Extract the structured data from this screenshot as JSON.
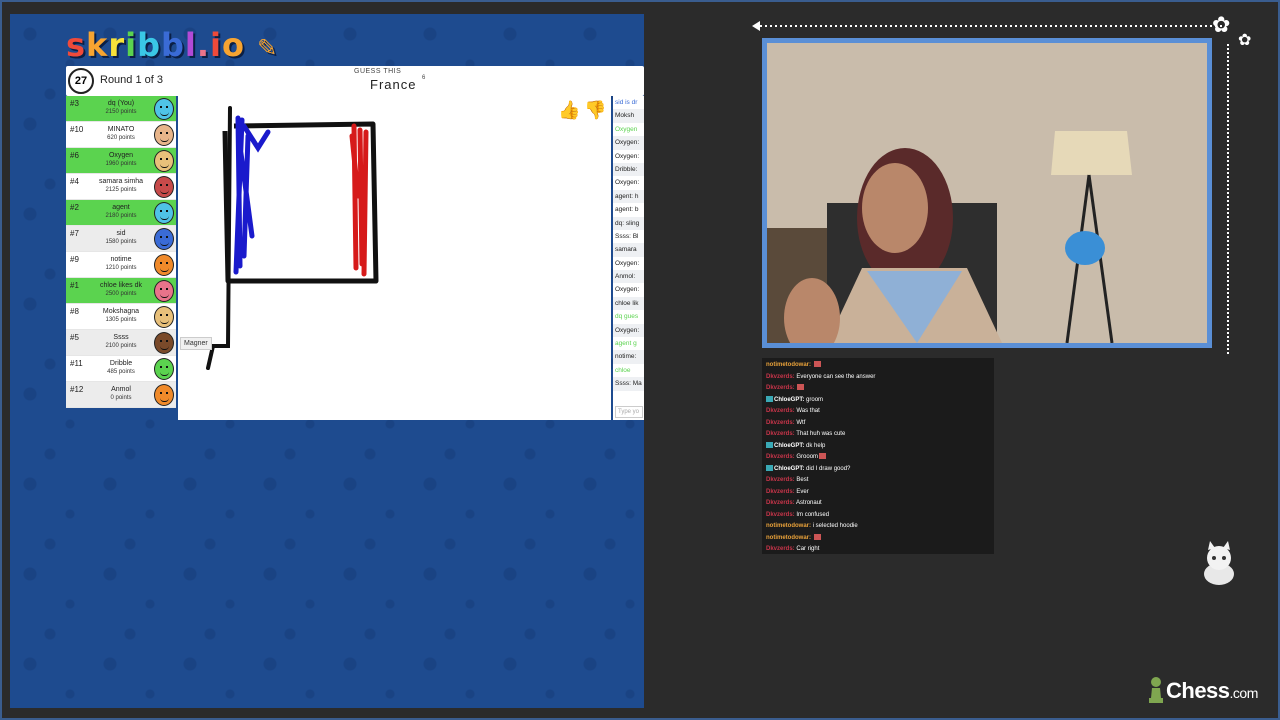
{
  "game": {
    "logo": "skribbl.io",
    "timer": "27",
    "round": "Round 1 of 3",
    "guess_label": "GUESS THIS",
    "word": "France",
    "word_length": "6",
    "drawer_tag": "Magner",
    "chat_placeholder": "Type yo",
    "players": [
      {
        "rank": "#3",
        "name": "dq (You)",
        "points": "2150 points",
        "style": "green",
        "avatar_color": "#4fc3e6"
      },
      {
        "rank": "#10",
        "name": "MINATO",
        "points": "620 points",
        "style": "white",
        "avatar_color": "#e8b58a"
      },
      {
        "rank": "#6",
        "name": "Oxygen",
        "points": "1960 points",
        "style": "green",
        "avatar_color": "#e8c07a"
      },
      {
        "rank": "#4",
        "name": "samara simha",
        "points": "2125 points",
        "style": "white",
        "avatar_color": "#c74a4a"
      },
      {
        "rank": "#2",
        "name": "agent",
        "points": "2180 points",
        "style": "green",
        "avatar_color": "#4fc3e6"
      },
      {
        "rank": "#7",
        "name": "sid",
        "points": "1580 points",
        "style": "grey",
        "avatar_color": "#3a6bd6"
      },
      {
        "rank": "#9",
        "name": "notime",
        "points": "1210 points",
        "style": "white",
        "avatar_color": "#f08a2a"
      },
      {
        "rank": "#1",
        "name": "chloe likes dk",
        "points": "2500 points",
        "style": "green",
        "avatar_color": "#e8738a"
      },
      {
        "rank": "#8",
        "name": "Mokshagna",
        "points": "1305 points",
        "style": "white",
        "avatar_color": "#e8c07a"
      },
      {
        "rank": "#5",
        "name": "Ssss",
        "points": "2100 points",
        "style": "grey",
        "avatar_color": "#7a4a2a"
      },
      {
        "rank": "#11",
        "name": "Dribble",
        "points": "485 points",
        "style": "white",
        "avatar_color": "#5bd34f"
      },
      {
        "rank": "#12",
        "name": "Anmol",
        "points": "0 points",
        "style": "grey",
        "avatar_color": "#f08a2a"
      }
    ],
    "chat": [
      {
        "text": "sid is dr",
        "style": "bluemsg"
      },
      {
        "text": "Moksh",
        "style": ""
      },
      {
        "text": "Oxygen",
        "style": "greenmsg"
      },
      {
        "text": "Oxygen:",
        "style": ""
      },
      {
        "text": "Oxygen:",
        "style": ""
      },
      {
        "text": "Dribble:",
        "style": ""
      },
      {
        "text": "Oxygen:",
        "style": ""
      },
      {
        "text": "agent: h",
        "style": ""
      },
      {
        "text": "agent: b",
        "style": ""
      },
      {
        "text": "dq: sling",
        "style": ""
      },
      {
        "text": "Ssss: Bl",
        "style": ""
      },
      {
        "text": "samara",
        "style": ""
      },
      {
        "text": "Oxygen:",
        "style": ""
      },
      {
        "text": "Anmol:",
        "style": ""
      },
      {
        "text": "Oxygen:",
        "style": ""
      },
      {
        "text": "chloe lik",
        "style": ""
      },
      {
        "text": "dq gues",
        "style": "greenmsg"
      },
      {
        "text": "Oxygen:",
        "style": ""
      },
      {
        "text": "agent g",
        "style": "greenmsg"
      },
      {
        "text": "notime:",
        "style": ""
      },
      {
        "text": "chloe",
        "style": "greenmsg"
      },
      {
        "text": "Ssss: Ma",
        "style": ""
      }
    ]
  },
  "stream_chat": [
    {
      "user": "notimetodowar:",
      "user_color": "orange",
      "badge": false,
      "text": "",
      "emote": true
    },
    {
      "user": "Dkvzerds:",
      "user_color": "red",
      "badge": false,
      "text": "Everyone can see the answer",
      "emote": false
    },
    {
      "user": "Dkvzerds:",
      "user_color": "red",
      "badge": false,
      "text": "",
      "emote": true
    },
    {
      "user": "ChloeGPT:",
      "user_color": "white",
      "badge": true,
      "text": "groom",
      "emote": false
    },
    {
      "user": "Dkvzerds:",
      "user_color": "red",
      "badge": false,
      "text": "Was that",
      "emote": false
    },
    {
      "user": "Dkvzerds:",
      "user_color": "red",
      "badge": false,
      "text": "Wtf",
      "emote": false
    },
    {
      "user": "Dkvzerds:",
      "user_color": "red",
      "badge": false,
      "text": "That huh was cute",
      "emote": false
    },
    {
      "user": "ChloeGPT:",
      "user_color": "white",
      "badge": true,
      "text": "dk help",
      "emote": false
    },
    {
      "user": "Dkvzerds:",
      "user_color": "red",
      "badge": false,
      "text": "Grooom",
      "emote": true
    },
    {
      "user": "ChloeGPT:",
      "user_color": "white",
      "badge": true,
      "text": "did I draw good?",
      "emote": false
    },
    {
      "user": "Dkvzerds:",
      "user_color": "red",
      "badge": false,
      "text": "Best",
      "emote": false
    },
    {
      "user": "Dkvzerds:",
      "user_color": "red",
      "badge": false,
      "text": "Ever",
      "emote": false
    },
    {
      "user": "Dkvzerds:",
      "user_color": "red",
      "badge": false,
      "text": "Astronaut",
      "emote": false
    },
    {
      "user": "Dkvzerds:",
      "user_color": "red",
      "badge": false,
      "text": "Im confused",
      "emote": false
    },
    {
      "user": "notimetodowar:",
      "user_color": "orange",
      "badge": false,
      "text": "i selected hoodie",
      "emote": false
    },
    {
      "user": "notimetodowar:",
      "user_color": "orange",
      "badge": false,
      "text": "",
      "emote": true
    },
    {
      "user": "Dkvzerds:",
      "user_color": "red",
      "badge": false,
      "text": "Car right",
      "emote": false
    }
  ],
  "brand": {
    "name": "Chess",
    "suffix": ".com"
  },
  "colors": {
    "game_bg": "#1e4b8f",
    "player_green": "#5bd34f",
    "cam_border": "#5a8fd6",
    "flag_blue": "#1a1acc",
    "flag_red": "#d61a1a"
  }
}
